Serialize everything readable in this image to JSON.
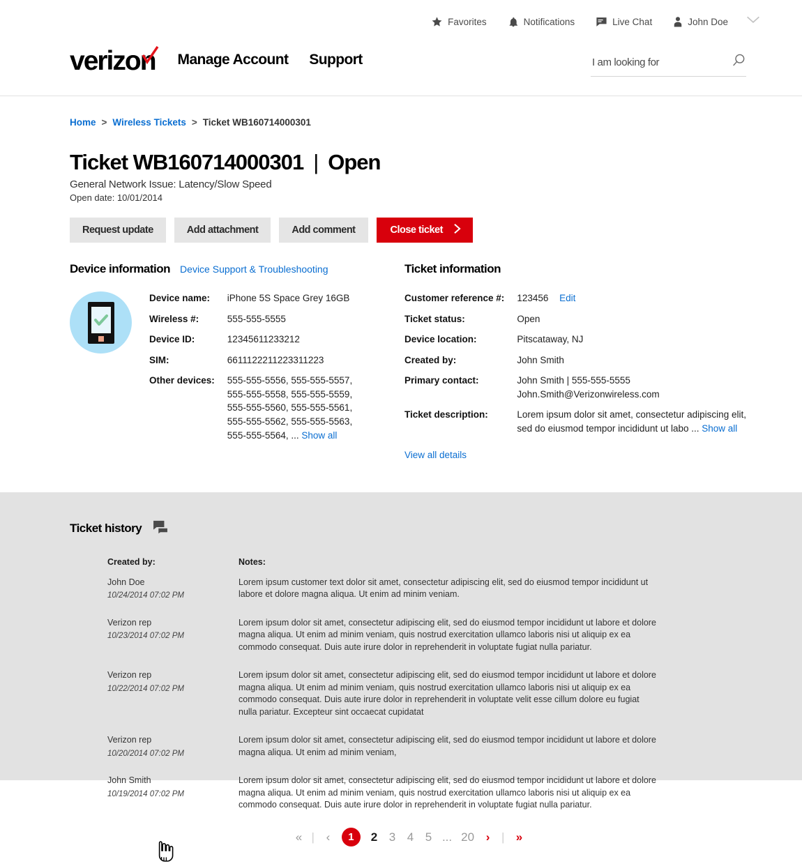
{
  "utility": {
    "items": [
      {
        "label": "Favorites",
        "icon": "star-icon"
      },
      {
        "label": "Notifications",
        "icon": "bell-icon"
      },
      {
        "label": "Live Chat",
        "icon": "chat-icon"
      },
      {
        "label": "John Doe",
        "icon": "person-icon"
      }
    ],
    "caret_icon": "chevron-down-icon"
  },
  "header": {
    "logo_text": "verizon",
    "nav": [
      {
        "label": "Manage Account"
      },
      {
        "label": "Support"
      }
    ],
    "search": {
      "placeholder": "I am looking for",
      "value": "",
      "icon": "search-icon"
    }
  },
  "breadcrumb": {
    "home": "Home",
    "sep1": ">",
    "section": "Wireless Tickets",
    "sep2": ">",
    "current": "Ticket WB160714000301"
  },
  "ticket": {
    "title": "Ticket WB160714000301",
    "divider": "|",
    "status": "Open",
    "subtitle": "General Network Issue: Latency/Slow Speed",
    "open_date": "Open date: 10/01/2014"
  },
  "actions": {
    "request_update": "Request update",
    "add_attachment": "Add attachment",
    "add_comment": "Add comment",
    "close_ticket": "Close ticket"
  },
  "device_info": {
    "title": "Device information",
    "support_link": "Device Support & Troubleshooting",
    "icon": "phone-check-icon",
    "fields": [
      {
        "label": "Device name:",
        "value": "iPhone 5S Space Grey 16GB"
      },
      {
        "label": "Wireless #:",
        "value": "555-555-5555"
      },
      {
        "label": "Device ID:",
        "value": "12345611233212"
      },
      {
        "label": "SIM:",
        "value": "6611122211223311223"
      }
    ],
    "other_devices_label": "Other devices:",
    "other_devices": "555-555-5556, 555-555-5557, 555-555-5558, 555-555-5559, 555-555-5560, 555-555-5561, 555-555-5562, 555-555-5563, 555-555-5564, ...",
    "show_all": "Show all"
  },
  "ticket_info": {
    "title": "Ticket information",
    "customer_ref_label": "Customer reference #:",
    "customer_ref_value": "123456",
    "edit_link": "Edit",
    "fields": [
      {
        "label": "Ticket status:",
        "value": "Open"
      },
      {
        "label": "Device location:",
        "value": "Pitscataway, NJ"
      },
      {
        "label": "Created by:",
        "value": "John Smith"
      }
    ],
    "primary_contact_label": "Primary contact:",
    "primary_contact_line1": "John Smith | 555-555-5555",
    "primary_contact_line2": "John.Smith@Verizonwireless.com",
    "description_label": "Ticket description:",
    "description_value": "Lorem ipsum dolor sit amet, consectetur adipiscing elit, sed do eiusmod tempor incididunt ut labo ...",
    "description_show_all": "Show all",
    "view_all_details": "View all details"
  },
  "history": {
    "title": "Ticket history",
    "icon": "chat-bubble-icon",
    "columns": {
      "created_by": "Created by:",
      "notes": "Notes:"
    },
    "rows": [
      {
        "who": "John Doe",
        "when": "10/24/2014 07:02 PM",
        "note": "Lorem ipsum customer text dolor sit amet, consectetur adipiscing elit, sed do eiusmod tempor incididunt ut labore et dolore magna aliqua. Ut enim ad minim veniam."
      },
      {
        "who": "Verizon rep",
        "when": "10/23/2014 07:02 PM",
        "note": "Lorem ipsum dolor sit amet, consectetur adipiscing elit, sed do eiusmod tempor incididunt ut labore et dolore magna aliqua. Ut enim ad minim veniam, quis nostrud exercitation ullamco laboris nisi ut aliquip ex ea commodo consequat. Duis aute irure dolor in reprehenderit in voluptate fugiat nulla pariatur."
      },
      {
        "who": "Verizon rep",
        "when": "10/22/2014 07:02 PM",
        "note": "Lorem ipsum dolor sit amet, consectetur adipiscing elit, sed do eiusmod tempor incididunt ut labore et dolore magna aliqua. Ut enim ad minim veniam, quis nostrud exercitation ullamco laboris nisi ut aliquip ex ea commodo consequat. Duis aute irure dolor in reprehenderit in voluptate velit esse cillum dolore eu fugiat nulla pariatur. Excepteur sint occaecat cupidatat"
      },
      {
        "who": "Verizon rep",
        "when": "10/20/2014 07:02 PM",
        "note": "Lorem ipsum dolor sit amet, consectetur adipiscing elit, sed do eiusmod tempor incididunt ut labore et dolore magna aliqua. Ut enim ad minim veniam,"
      },
      {
        "who": "John Smith",
        "when": "10/19/2014 07:02 PM",
        "note": "Lorem ipsum dolor sit amet, consectetur adipiscing elit, sed do eiusmod tempor incididunt ut labore et dolore magna aliqua. Ut enim ad minim veniam, quis nostrud exercitation ullamco laboris nisi ut aliquip ex ea commodo consequat. Duis aute irure dolor in reprehenderit in voluptate fugiat nulla pariatur."
      }
    ]
  },
  "pagination": {
    "first": "«",
    "prev": "‹",
    "pages": [
      "1",
      "2",
      "3",
      "4",
      "5",
      "...",
      "20"
    ],
    "active_page": "1",
    "hovered_page": "2",
    "next": "›",
    "last": "»"
  },
  "colors": {
    "verizon_red": "#d8000c",
    "link_blue": "#0a6ed1",
    "history_bg": "#e2e2e2",
    "device_circle": "#ade0f7",
    "check_green": "#7ec89a"
  }
}
